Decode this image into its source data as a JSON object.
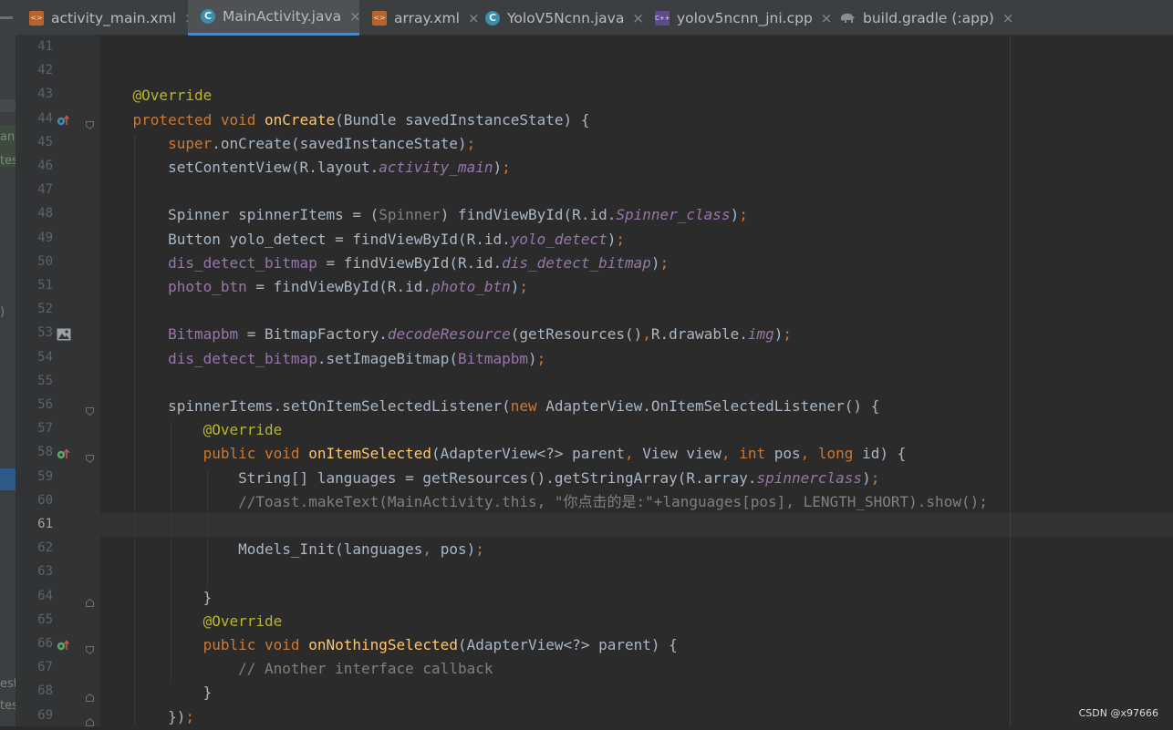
{
  "tabs": [
    {
      "label": "activity_main.xml",
      "icon": "xml-file-icon",
      "active": false
    },
    {
      "label": "MainActivity.java",
      "icon": "java-class-icon",
      "active": true
    },
    {
      "label": "array.xml",
      "icon": "xml-file-icon",
      "active": false
    },
    {
      "label": "YoloV5Ncnn.java",
      "icon": "java-class-icon",
      "active": false
    },
    {
      "label": "yolov5ncnn_jni.cpp",
      "icon": "cpp-file-icon",
      "active": false
    },
    {
      "label": "build.gradle (:app)",
      "icon": "gradle-elephant-icon",
      "active": false
    }
  ],
  "tab_close_glyph": "×",
  "left_panel_fragments": [
    "anc",
    "tes",
    ")",
    "est",
    "tes"
  ],
  "current_line": 61,
  "lines": [
    {
      "n": "41",
      "t": []
    },
    {
      "n": "42",
      "t": []
    },
    {
      "n": "43",
      "t": [
        [
          "an",
          "    @Override"
        ]
      ]
    },
    {
      "n": "44",
      "marker": "override-up",
      "t": [
        [
          "kw",
          "    protected void "
        ],
        [
          "fn",
          "onCreate"
        ],
        [
          "",
          "(Bundle savedInstanceState) {"
        ]
      ]
    },
    {
      "n": "45",
      "t": [
        [
          "kw",
          "        super"
        ],
        [
          "",
          "."
        ],
        [
          "",
          "onCreate(savedInstanceState)"
        ],
        [
          "kw",
          ";"
        ]
      ]
    },
    {
      "n": "46",
      "t": [
        [
          "",
          "        setContentView(R.layout."
        ],
        [
          "fi",
          "activity_main"
        ],
        [
          "",
          ")"
        ],
        [
          "kw",
          ";"
        ]
      ]
    },
    {
      "n": "47",
      "t": []
    },
    {
      "n": "48",
      "t": [
        [
          "",
          "        Spinner spinnerItems = ("
        ],
        [
          "gr",
          "Spinner"
        ],
        [
          "",
          ") findViewById(R.id."
        ],
        [
          "fi",
          "Spinner_class"
        ],
        [
          "",
          ")"
        ],
        [
          "kw",
          ";"
        ]
      ]
    },
    {
      "n": "49",
      "t": [
        [
          "",
          "        Button yolo_detect = findViewById(R.id."
        ],
        [
          "fi",
          "yolo_detect"
        ],
        [
          "",
          ")"
        ],
        [
          "kw",
          ";"
        ]
      ]
    },
    {
      "n": "50",
      "t": [
        [
          "fd",
          "        dis_detect_bitmap"
        ],
        [
          "",
          " = findViewById(R.id."
        ],
        [
          "fi",
          "dis_detect_bitmap"
        ],
        [
          "",
          ")"
        ],
        [
          "kw",
          ";"
        ]
      ]
    },
    {
      "n": "51",
      "t": [
        [
          "fd",
          "        photo_btn"
        ],
        [
          "",
          " = findViewById(R.id."
        ],
        [
          "fi",
          "photo_btn"
        ],
        [
          "",
          ")"
        ],
        [
          "kw",
          ";"
        ]
      ]
    },
    {
      "n": "52",
      "t": []
    },
    {
      "n": "53",
      "marker": "image",
      "t": [
        [
          "fd",
          "        Bitmapbm"
        ],
        [
          "",
          " = BitmapFactory."
        ],
        [
          "fi",
          "decodeResource"
        ],
        [
          "",
          "(getResources()"
        ],
        [
          "kw",
          ","
        ],
        [
          "",
          "R.drawable."
        ],
        [
          "fi",
          "img"
        ],
        [
          "",
          ")"
        ],
        [
          "kw",
          ";"
        ]
      ]
    },
    {
      "n": "54",
      "t": [
        [
          "fd",
          "        dis_detect_bitmap"
        ],
        [
          "",
          ".setImageBitmap("
        ],
        [
          "fd",
          "Bitmapbm"
        ],
        [
          "",
          ")"
        ],
        [
          "kw",
          ";"
        ]
      ]
    },
    {
      "n": "55",
      "t": []
    },
    {
      "n": "56",
      "t": [
        [
          "",
          "        spinnerItems.setOnItemSelectedListener("
        ],
        [
          "kw",
          "new "
        ],
        [
          "",
          "AdapterView.OnItemSelectedListener() {"
        ]
      ]
    },
    {
      "n": "57",
      "t": [
        [
          "an",
          "            @Override"
        ]
      ]
    },
    {
      "n": "58",
      "marker": "implements-up",
      "t": [
        [
          "kw",
          "            public void "
        ],
        [
          "fn",
          "onItemSelected"
        ],
        [
          "",
          "(AdapterView<?> parent"
        ],
        [
          "kw",
          ", "
        ],
        [
          "",
          "View view"
        ],
        [
          "kw",
          ", int "
        ],
        [
          "",
          "pos"
        ],
        [
          "kw",
          ", long "
        ],
        [
          "",
          "id) {"
        ]
      ]
    },
    {
      "n": "59",
      "t": [
        [
          "",
          "                String[] languages = getResources().getStringArray(R.array."
        ],
        [
          "fi",
          "spinnerclass"
        ],
        [
          "",
          ")"
        ],
        [
          "kw",
          ";"
        ]
      ]
    },
    {
      "n": "60",
      "t": [
        [
          "cm",
          "                //Toast.makeText(MainActivity.this, \"你点击的是:\"+languages[pos], LENGTH_SHORT).show();"
        ]
      ]
    },
    {
      "n": "61",
      "t": []
    },
    {
      "n": "62",
      "t": [
        [
          "",
          "                Models_Init(languages"
        ],
        [
          "kw",
          ", "
        ],
        [
          "",
          "pos)"
        ],
        [
          "kw",
          ";"
        ]
      ]
    },
    {
      "n": "63",
      "t": []
    },
    {
      "n": "64",
      "t": [
        [
          "",
          "            }"
        ]
      ]
    },
    {
      "n": "65",
      "t": [
        [
          "an",
          "            @Override"
        ]
      ]
    },
    {
      "n": "66",
      "marker": "implements-up",
      "t": [
        [
          "kw",
          "            public void "
        ],
        [
          "fn",
          "onNothingSelected"
        ],
        [
          "",
          "(AdapterView<?> parent) {"
        ]
      ]
    },
    {
      "n": "67",
      "t": [
        [
          "cm",
          "                // Another interface callback"
        ]
      ]
    },
    {
      "n": "68",
      "t": [
        [
          "",
          "            }"
        ]
      ]
    },
    {
      "n": "69",
      "t": [
        [
          "",
          "        })"
        ],
        [
          "kw",
          ";"
        ]
      ]
    }
  ],
  "watermark": "CSDN @x97666",
  "colors": {
    "accent": "#4a88c7",
    "keyword": "#cc7832",
    "method": "#ffc66d",
    "annotation": "#bbb529",
    "field": "#9876aa",
    "comment": "#808080",
    "text": "#a9b7c6"
  }
}
